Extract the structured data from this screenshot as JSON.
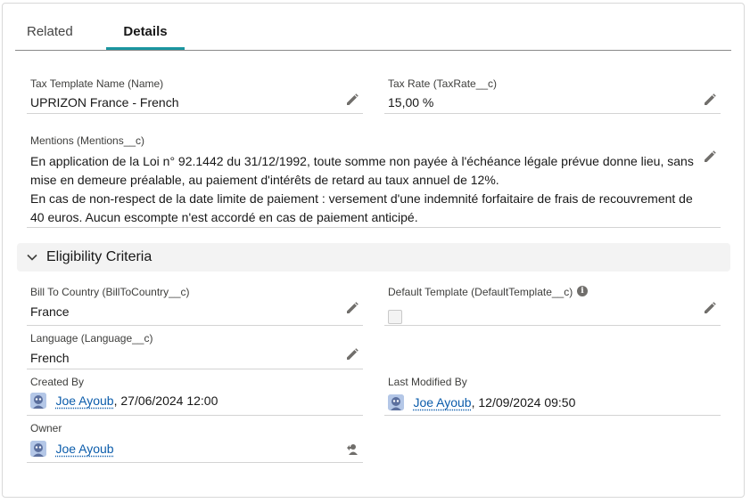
{
  "tabs": [
    {
      "label": "Related"
    },
    {
      "label": "Details"
    }
  ],
  "fields": {
    "tax_template_name": {
      "label": "Tax Template Name (Name)",
      "value": "UPRIZON France - French"
    },
    "tax_rate": {
      "label": "Tax Rate (TaxRate__c)",
      "value": "15,00 %"
    },
    "mentions": {
      "label": "Mentions (Mentions__c)",
      "line1": "En application de la Loi n° 92.1442 du 31/12/1992, toute somme non payée à l'échéance légale prévue donne lieu, sans mise en demeure préalable, au paiement d'intérêts de retard au taux annuel de 12%.",
      "line2": "En cas de non-respect de la date limite de paiement : versement d'une indemnité forfaitaire de frais de recouvrement de 40 euros. Aucun escompte n'est accordé en cas de paiement anticipé."
    },
    "bill_to_country": {
      "label": "Bill To Country (BillToCountry__c)",
      "value": "France"
    },
    "default_template": {
      "label": "Default Template (DefaultTemplate__c)",
      "checked": false
    },
    "language": {
      "label": "Language (Language__c)",
      "value": "French"
    },
    "created_by": {
      "label": "Created By",
      "user": "Joe Ayoub",
      "date": ", 27/06/2024 12:00"
    },
    "last_modified_by": {
      "label": "Last Modified By",
      "user": "Joe Ayoub",
      "date": ", 12/09/2024 09:50"
    },
    "owner": {
      "label": "Owner",
      "user": "Joe Ayoub"
    }
  },
  "section": {
    "title": "Eligibility Criteria",
    "expanded": true
  },
  "icons": {
    "edit": "pencil-icon",
    "info": "info-icon",
    "chevron": "chevron-down-icon",
    "change_owner": "change-owner-icon",
    "avatar": "user-avatar-icon"
  },
  "colors": {
    "accent": "#1b96a0",
    "link": "#0b5cab",
    "section_bg": "#f3f3f3"
  }
}
